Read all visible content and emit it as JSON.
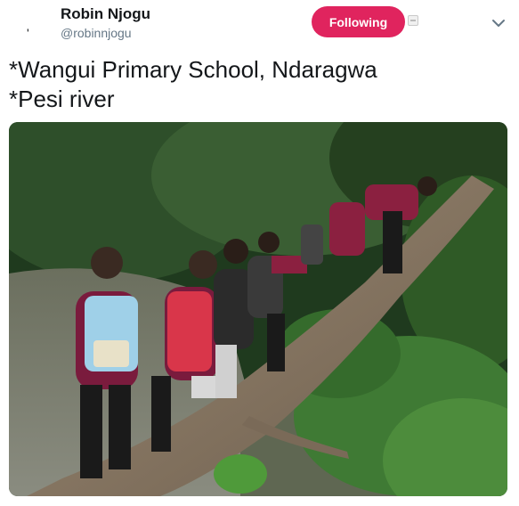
{
  "author": {
    "name": "Robin Njogu",
    "handle": "@robinnjogu",
    "avatar_glyph": "'"
  },
  "follow_button": {
    "label": "Following",
    "color": "#e0245e"
  },
  "icons": {
    "more": "chevron-down-icon",
    "badge": "mini-badge-icon"
  },
  "tweet": {
    "lines": [
      "*Wangui Primary School, Ndaragwa",
      "*Pesi river"
    ]
  },
  "media": {
    "type": "photo",
    "alt": "Schoolchildren with backpacks crossing a river on a fallen tree"
  }
}
